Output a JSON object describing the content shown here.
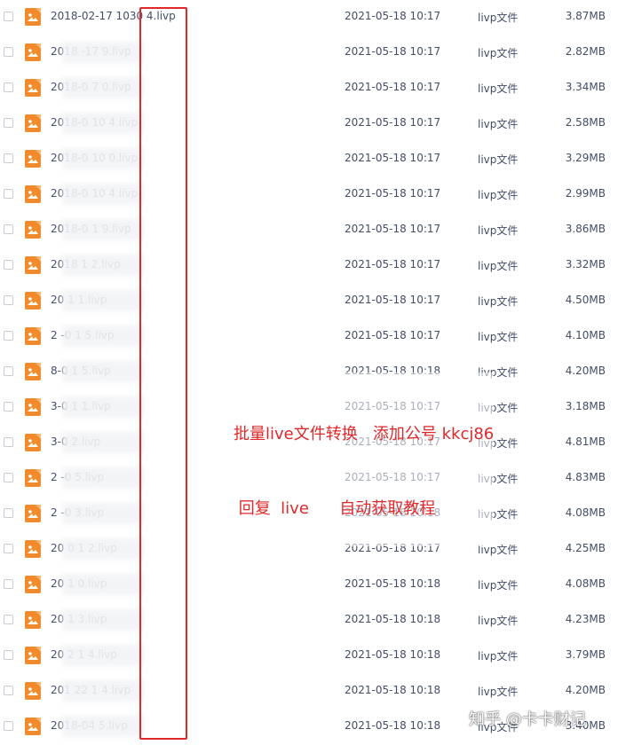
{
  "file_type_label": "livp文件",
  "files": [
    {
      "name": "2018-02-17 1030 4.livp",
      "date": "2021-05-18 10:17",
      "type": "livp文件",
      "size": "3.87MB"
    },
    {
      "name": "2018 -17 9.livp",
      "date": "2021-05-18 10:17",
      "type": "livp文件",
      "size": "2.82MB"
    },
    {
      "name": "2018-0 7 0.livp",
      "date": "2021-05-18 10:17",
      "type": "livp文件",
      "size": "3.34MB"
    },
    {
      "name": "2018-0 10 4.livp",
      "date": "2021-05-18 10:17",
      "type": "livp文件",
      "size": "2.58MB"
    },
    {
      "name": "2018-0 10 0.livp",
      "date": "2021-05-18 10:17",
      "type": "livp文件",
      "size": "3.29MB"
    },
    {
      "name": "2018-0 10 4.livp",
      "date": "2021-05-18 10:17",
      "type": "livp文件",
      "size": "2.99MB"
    },
    {
      "name": "2018-0 1 9.livp",
      "date": "2021-05-18 10:17",
      "type": "livp文件",
      "size": "3.86MB"
    },
    {
      "name": "2018 1 2.livp",
      "date": "2021-05-18 10:17",
      "type": "livp文件",
      "size": "3.32MB"
    },
    {
      "name": "20 1 1.livp",
      "date": "2021-05-18 10:17",
      "type": "livp文件",
      "size": "4.50MB"
    },
    {
      "name": "2 -0 1 5.livp",
      "date": "2021-05-18 10:17",
      "type": "livp文件",
      "size": "4.10MB"
    },
    {
      "name": " 8-0 1 5.livp",
      "date": "2021-05-18 10:18",
      "type": "livp文件",
      "size": "4.20MB"
    },
    {
      "name": " 3-0 1 1.livp",
      "date": "2021-05-18 10:17",
      "type": "livp文件",
      "size": "3.18MB"
    },
    {
      "name": " 3-0 2.livp",
      "date": "2021-05-18 10:17",
      "type": "livp文件",
      "size": "4.81MB"
    },
    {
      "name": "2 -0 5.livp",
      "date": "2021-05-18 10:17",
      "type": "livp文件",
      "size": "4.83MB"
    },
    {
      "name": "2 -0 3.livp",
      "date": "2021-05-18 10:18",
      "type": "livp文件",
      "size": "4.08MB"
    },
    {
      "name": "20 0 1 2.livp",
      "date": "2021-05-18 10:17",
      "type": "livp文件",
      "size": "4.25MB"
    },
    {
      "name": "20 1 0.livp",
      "date": "2021-05-18 10:18",
      "type": "livp文件",
      "size": "4.08MB"
    },
    {
      "name": "20 1 3.livp",
      "date": "2021-05-18 10:18",
      "type": "livp文件",
      "size": "4.23MB"
    },
    {
      "name": "20 2 1 4.livp",
      "date": "2021-05-18 10:18",
      "type": "livp文件",
      "size": "3.79MB"
    },
    {
      "name": "201 22 1 4.livp",
      "date": "2021-05-18 10:18",
      "type": "livp文件",
      "size": "4.20MB"
    },
    {
      "name": "2018-04 5.livp",
      "date": "2021-05-18 10:18",
      "type": "livp文件",
      "size": "3.40MB"
    }
  ],
  "overlay": {
    "line1": "批量live文件转换   添加公号 kkcj86",
    "line2": " 回复  live      自动获取教程"
  },
  "watermark": "知乎 @卡卡财记",
  "colors": {
    "icon_orange": "#f28b2c",
    "highlight_red": "#e0282b",
    "text": "#424e67"
  },
  "icons": {
    "file": "image-file-icon",
    "checkbox": "checkbox-icon"
  }
}
